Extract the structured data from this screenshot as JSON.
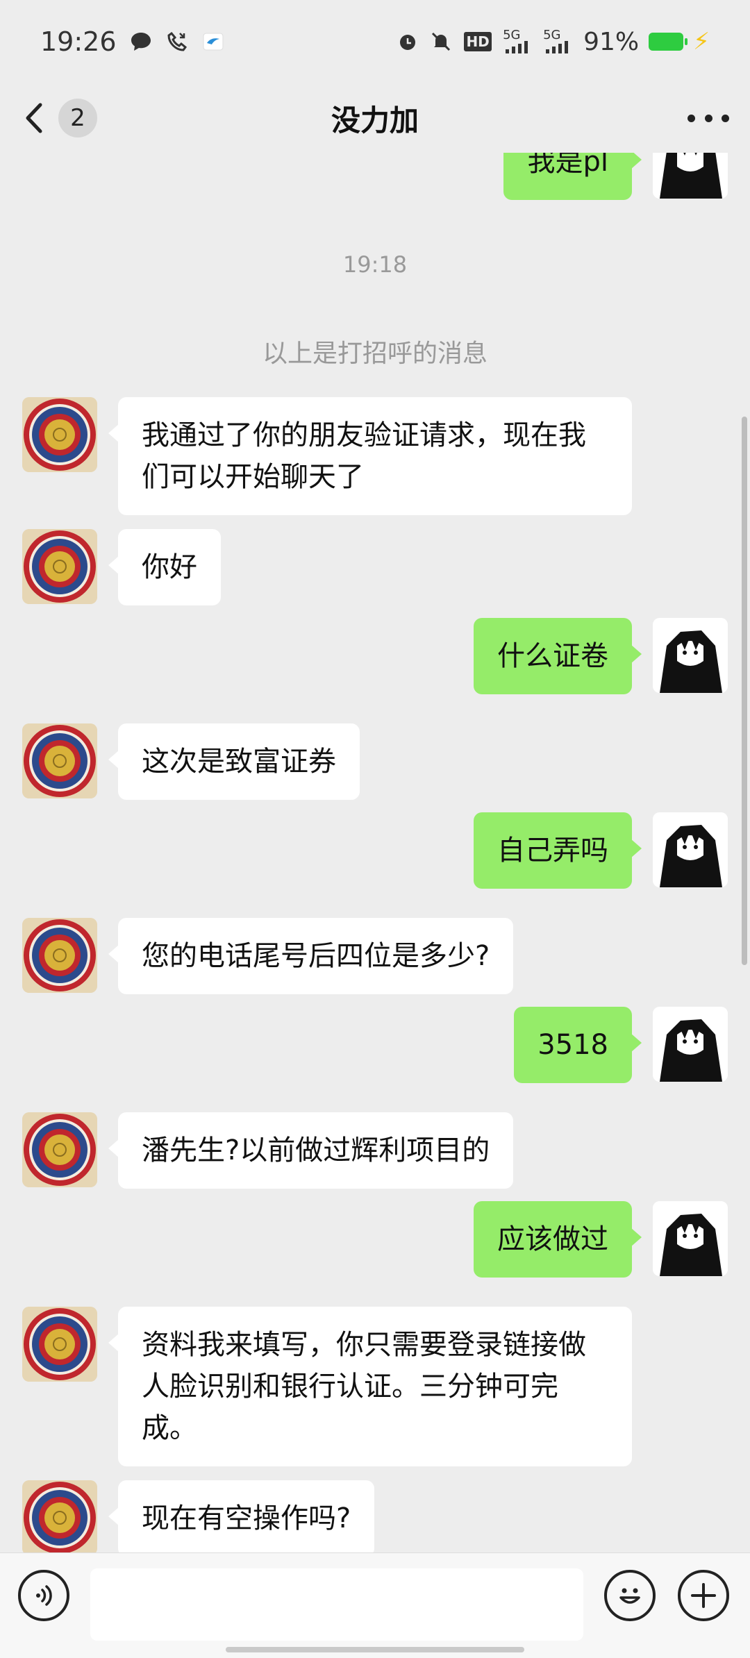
{
  "status_bar": {
    "time": "19:26",
    "icons_left": [
      "chat-bubble-icon",
      "missed-call-icon",
      "app-notification-icon"
    ],
    "icons_right": [
      "alarm-icon",
      "mute-icon",
      "hd-icon",
      "signal-5g-icon",
      "signal-5g-icon"
    ],
    "hd_label": "HD",
    "signal1_label": "5G",
    "signal2_label": "5G",
    "battery_percent": "91%",
    "battery_level": 0.91,
    "charging": true
  },
  "nav": {
    "unread_count": "2",
    "title": "没力加",
    "more_icon": "more-dots-icon"
  },
  "chat": {
    "partial_top_message": "我是pl",
    "timestamp": "19:18",
    "greeting_note": "以上是打招呼的消息",
    "messages": [
      {
        "side": "left",
        "text": "我通过了你的朋友验证请求，现在我们可以开始聊天了"
      },
      {
        "side": "left",
        "text": "你好"
      },
      {
        "side": "right",
        "text": "什么证卷"
      },
      {
        "side": "left",
        "text": "这次是致富证券"
      },
      {
        "side": "right",
        "text": "自己弄吗"
      },
      {
        "side": "left",
        "text": "您的电话尾号后四位是多少?"
      },
      {
        "side": "right",
        "text": "3518"
      },
      {
        "side": "left",
        "text": "潘先生?以前做过辉利项目的"
      },
      {
        "side": "right",
        "text": "应该做过"
      },
      {
        "side": "left",
        "text": "资料我来填写，你只需要登录链接做人脸识别和银行认证。三分钟可完成。"
      },
      {
        "side": "left",
        "text": "现在有空操作吗?"
      }
    ]
  },
  "input_bar": {
    "voice_icon": "voice-icon",
    "emoji_icon": "emoji-icon",
    "plus_icon": "plus-icon",
    "placeholder": ""
  },
  "colors": {
    "background": "#ededed",
    "self_bubble": "#95ec69",
    "other_bubble": "#ffffff"
  }
}
